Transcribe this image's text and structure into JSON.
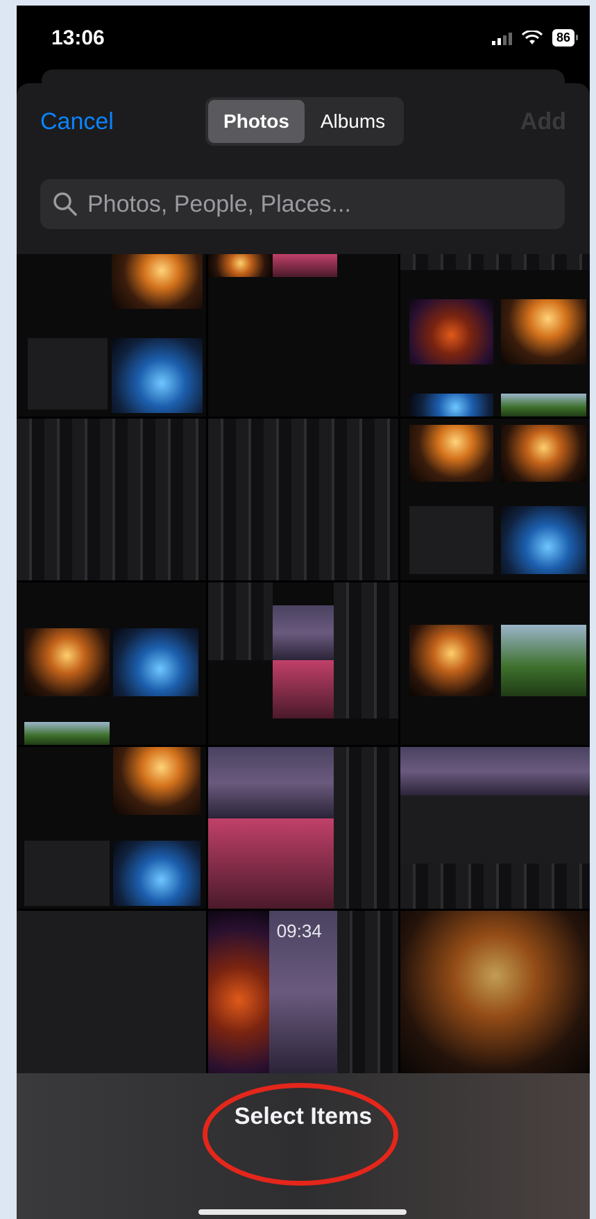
{
  "status_bar": {
    "time": "13:06",
    "battery": "86"
  },
  "nav": {
    "cancel_label": "Cancel",
    "add_label": "Add",
    "segments": [
      "Photos",
      "Albums"
    ],
    "active_segment": "Photos"
  },
  "search": {
    "placeholder": "Photos, People, Places..."
  },
  "thumb_texts": {
    "lockscreen_time": "09:34"
  },
  "bottom": {
    "select_items_label": "Select Items"
  },
  "colors": {
    "accent": "#0a84ff",
    "highlight_ring": "#e5261b",
    "sheet_bg": "#1c1c1e"
  }
}
